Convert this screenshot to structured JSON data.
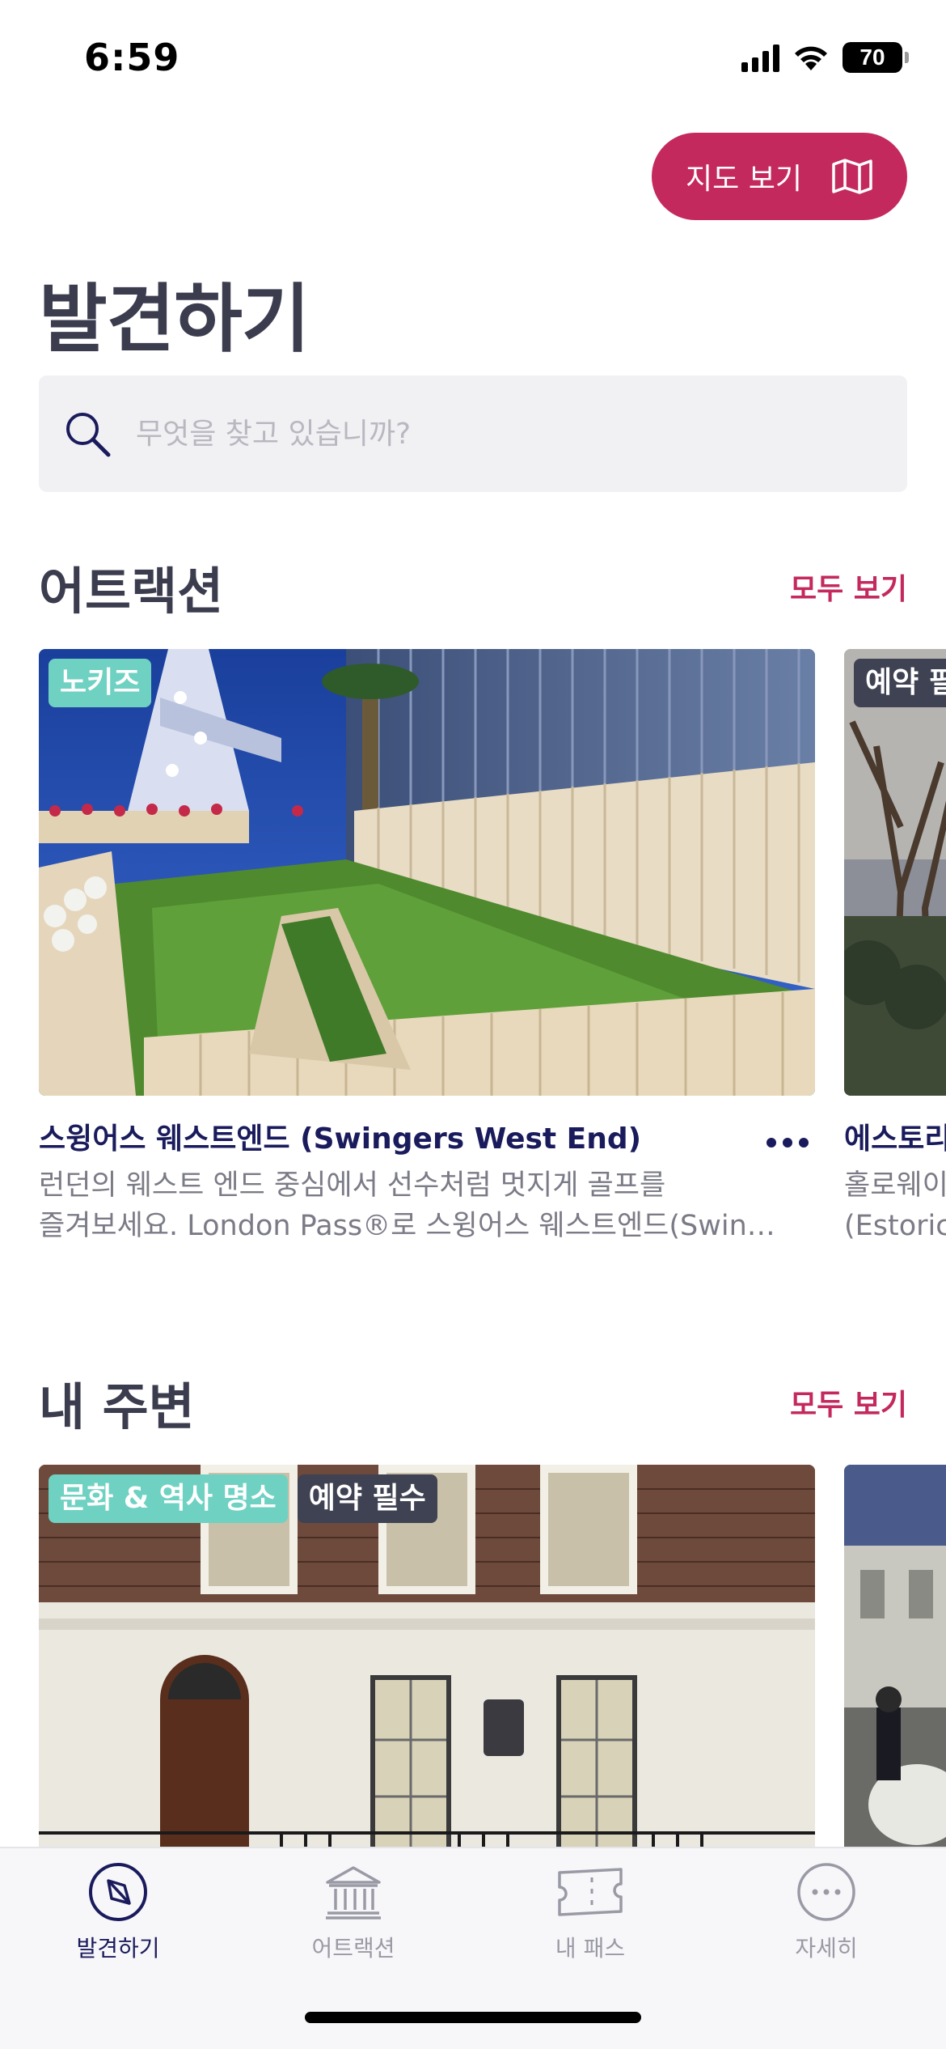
{
  "status_bar": {
    "time": "6:59",
    "battery": "70"
  },
  "header": {
    "map_button_label": "지도 보기",
    "title": "발견하기"
  },
  "search": {
    "placeholder": "무엇을 찾고 있습니까?"
  },
  "attractions": {
    "title": "어트랙션",
    "see_all": "모두 보기",
    "cards": [
      {
        "badges": [
          "노키즈"
        ],
        "title": "스윙어스 웨스트엔드 (Swingers West End)",
        "desc_line1": "런던의 웨스트 엔드 중심에서 선수처럼 멋지게 골프를",
        "desc_line2": "즐겨보세요. London Pass®로 스윙어스 웨스트엔드(Swin…"
      },
      {
        "badges": [
          "예약 필"
        ],
        "title": "에스토리",
        "desc_line1": "홀로웨이",
        "desc_line2": "(Estoric"
      }
    ]
  },
  "nearby": {
    "title": "내 주변",
    "see_all": "모두 보기",
    "cards": [
      {
        "badges": [
          "문화 & 역사 명소",
          "예약 필수"
        ]
      },
      {
        "badges": []
      }
    ]
  },
  "tab_bar": {
    "tabs": [
      {
        "label": "발견하기",
        "icon": "compass-icon",
        "active": true
      },
      {
        "label": "어트랙션",
        "icon": "museum-icon",
        "active": false
      },
      {
        "label": "내 패스",
        "icon": "ticket-icon",
        "active": false
      },
      {
        "label": "자세히",
        "icon": "more-icon",
        "active": false
      }
    ]
  },
  "colors": {
    "accent": "#c4295e",
    "navy": "#1a1b5c",
    "teal_badge": "#6fd1c2",
    "dark_badge": "#3e4252"
  }
}
